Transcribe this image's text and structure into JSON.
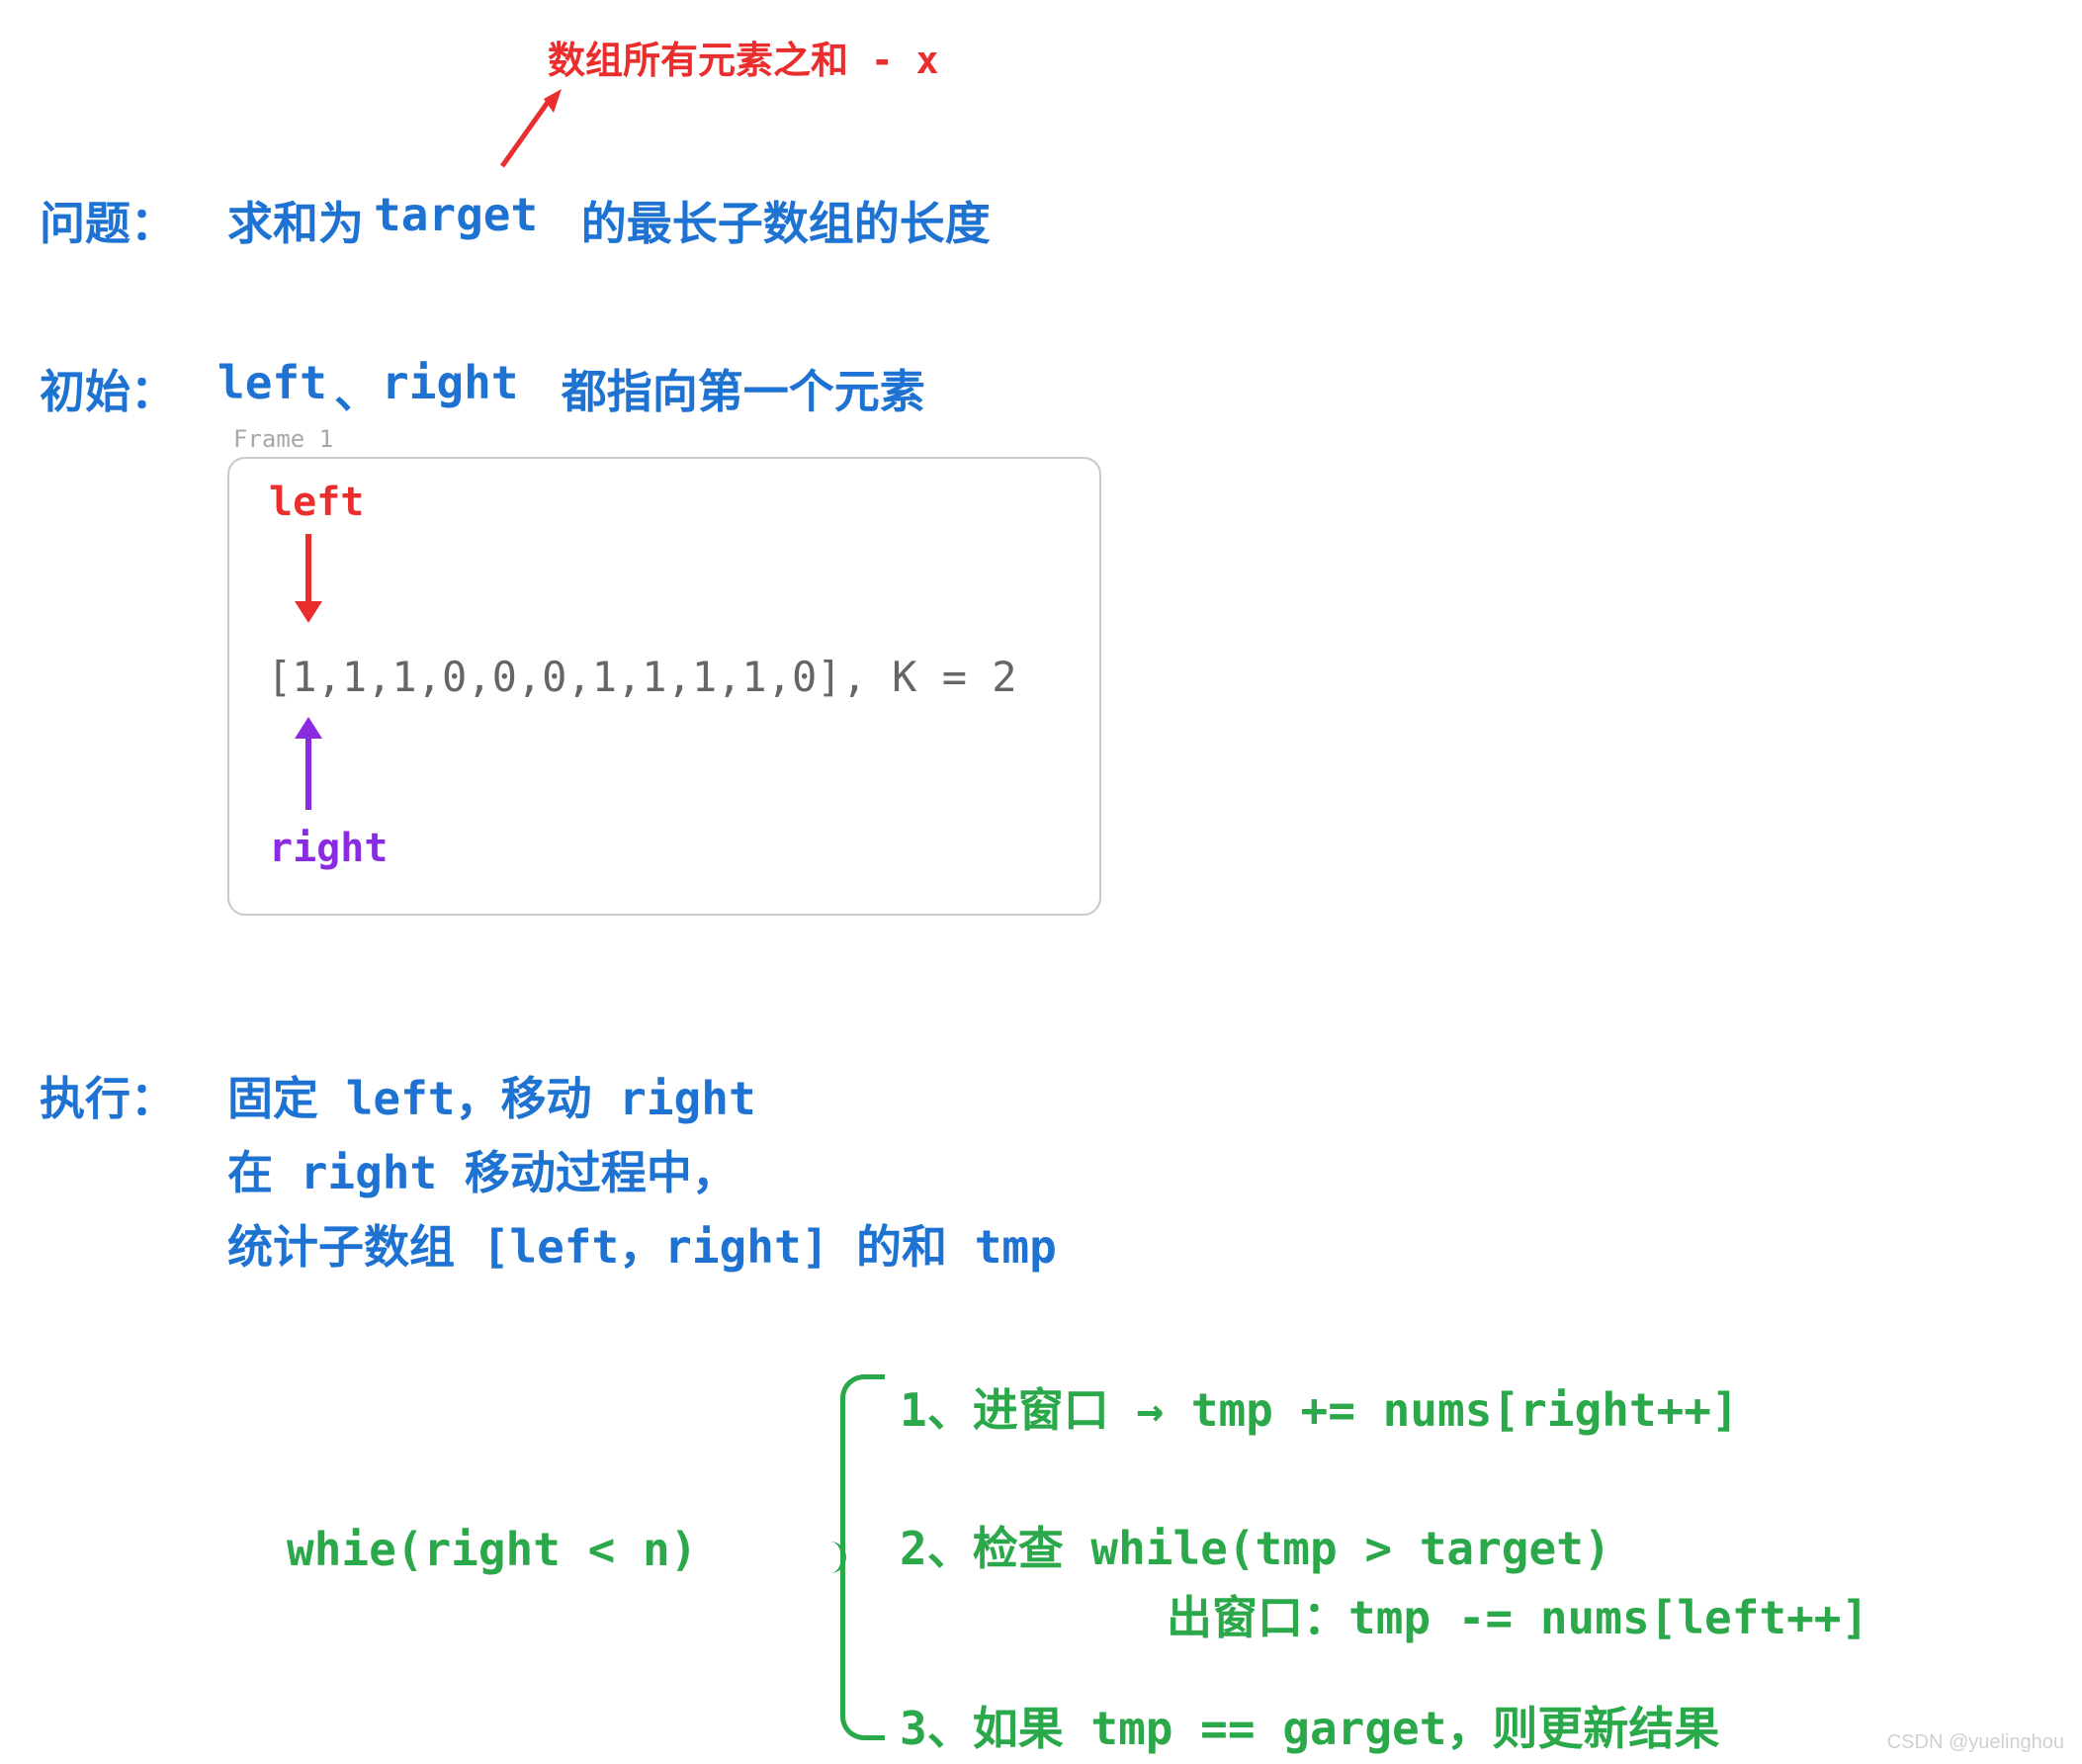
{
  "annotation": {
    "text": "数组所有元素之和 - x"
  },
  "problem": {
    "label": "问题：",
    "before": "求和为 ",
    "keyword": "target",
    "after": " 的最长子数组的长度"
  },
  "init": {
    "label": "初始：",
    "left_kw": "left",
    "sep": "、",
    "right_kw": "right",
    "after": " 都指向第一个元素"
  },
  "frame": {
    "title": "Frame 1",
    "left_label": "left",
    "right_label": "right",
    "array_text": "[1,1,1,0,0,0,1,1,1,1,0], K = 2"
  },
  "exec": {
    "label": "执行：",
    "line1": "固定 left，移动 right",
    "line2": "在 right 移动过程中，",
    "line3": "统计子数组 [left，right] 的和 tmp"
  },
  "loop": {
    "while": "whie(right < n)",
    "step1": "1、进窗口 → tmp += nums[right++]",
    "step2a": "2、检查 while(tmp > target)",
    "step2b": "出窗口：tmp -= nums[left++]",
    "step3": "3、如果 tmp == garget，则更新结果"
  },
  "watermark": "CSDN @yuelinghou"
}
